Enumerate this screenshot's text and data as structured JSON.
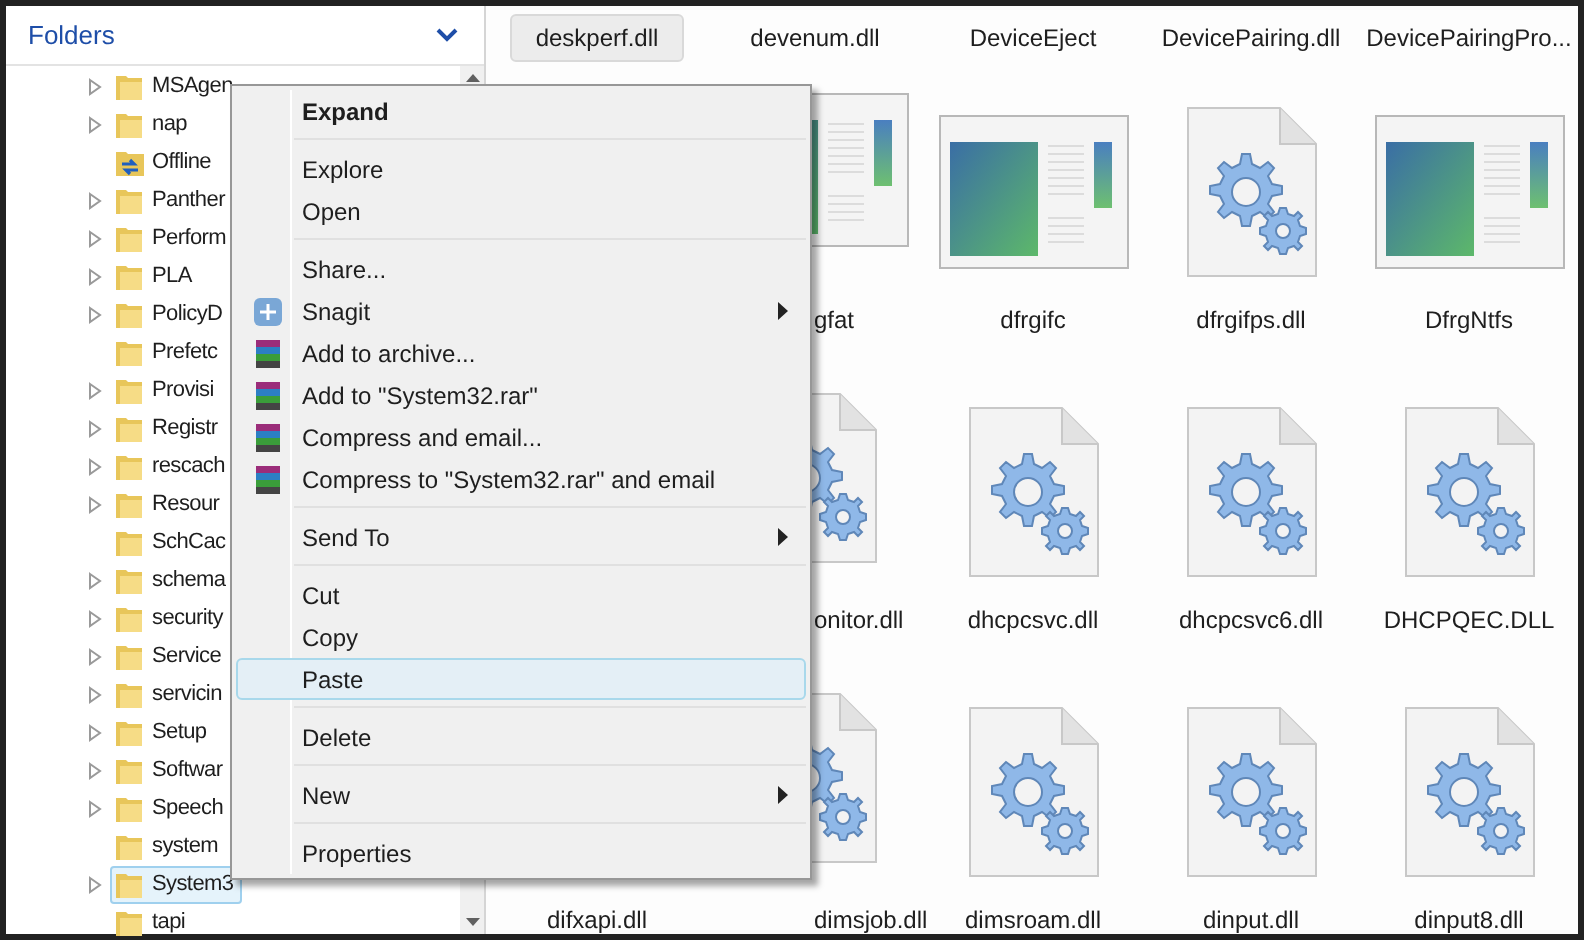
{
  "folders_pane": {
    "title": "Folders",
    "tree": [
      {
        "label": "MSAgen",
        "expander": true,
        "kind": "folder",
        "selected": false
      },
      {
        "label": "nap",
        "expander": true,
        "kind": "folder",
        "selected": false
      },
      {
        "label": "Offline",
        "expander": false,
        "kind": "sync",
        "selected": false
      },
      {
        "label": "Panther",
        "expander": true,
        "kind": "folder",
        "selected": false
      },
      {
        "label": "Perform",
        "expander": true,
        "kind": "folder",
        "selected": false
      },
      {
        "label": "PLA",
        "expander": true,
        "kind": "folder",
        "selected": false
      },
      {
        "label": "PolicyD",
        "expander": true,
        "kind": "folder",
        "selected": false
      },
      {
        "label": "Prefetc",
        "expander": false,
        "kind": "folder",
        "selected": false
      },
      {
        "label": "Provisi",
        "expander": true,
        "kind": "folder",
        "selected": false
      },
      {
        "label": "Registr",
        "expander": true,
        "kind": "folder",
        "selected": false
      },
      {
        "label": "rescach",
        "expander": true,
        "kind": "folder",
        "selected": false
      },
      {
        "label": "Resour",
        "expander": true,
        "kind": "folder",
        "selected": false
      },
      {
        "label": "SchCac",
        "expander": false,
        "kind": "folder",
        "selected": false
      },
      {
        "label": "schema",
        "expander": true,
        "kind": "folder",
        "selected": false
      },
      {
        "label": "security",
        "expander": true,
        "kind": "folder",
        "selected": false
      },
      {
        "label": "Service",
        "expander": true,
        "kind": "folder",
        "selected": false
      },
      {
        "label": "servicin",
        "expander": true,
        "kind": "folder",
        "selected": false
      },
      {
        "label": "Setup",
        "expander": true,
        "kind": "folder",
        "selected": false
      },
      {
        "label": "Softwar",
        "expander": true,
        "kind": "folder",
        "selected": false
      },
      {
        "label": "Speech",
        "expander": true,
        "kind": "folder",
        "selected": false
      },
      {
        "label": "system",
        "expander": false,
        "kind": "folder",
        "selected": false
      },
      {
        "label": "System3",
        "expander": true,
        "kind": "folder",
        "selected": true
      },
      {
        "label": "tapi",
        "expander": false,
        "kind": "folder",
        "selected": false
      }
    ]
  },
  "files": {
    "rows": [
      {
        "items": [
          {
            "label": "deskperf.dll",
            "kind": "label",
            "selected": true
          },
          {
            "label": "devenum.dll",
            "kind": "label",
            "selected": false
          },
          {
            "label": "DeviceEject",
            "kind": "label",
            "selected": false
          },
          {
            "label": "DevicePairing.dll",
            "kind": "label",
            "selected": false
          },
          {
            "label": "DevicePairingPro...",
            "kind": "label",
            "selected": false
          }
        ]
      },
      {
        "items": [
          {
            "label": "gfat",
            "kind": "app",
            "selected": false
          },
          {
            "label": "dfrgifc",
            "kind": "app",
            "selected": false
          },
          {
            "label": "dfrgifps.dll",
            "kind": "gear",
            "selected": false
          },
          {
            "label": "DfrgNtfs",
            "kind": "app",
            "selected": false
          }
        ]
      },
      {
        "items": [
          {
            "label": "onitor.dll",
            "kind": "gear",
            "selected": false
          },
          {
            "label": "dhcpcsvc.dll",
            "kind": "gear",
            "selected": false
          },
          {
            "label": "dhcpcsvc6.dll",
            "kind": "gear",
            "selected": false
          },
          {
            "label": "DHCPQEC.DLL",
            "kind": "gear",
            "selected": false
          }
        ]
      },
      {
        "items": [
          {
            "label": "difxapi.dll",
            "kind": "label",
            "selected": false
          },
          {
            "label": "dimsjob.dll",
            "kind": "gear",
            "selected": false
          },
          {
            "label": "dimsroam.dll",
            "kind": "gear",
            "selected": false
          },
          {
            "label": "dinput.dll",
            "kind": "gear",
            "selected": false
          },
          {
            "label": "dinput8.dll",
            "kind": "gear",
            "selected": false
          }
        ]
      }
    ]
  },
  "context_menu": {
    "items": [
      {
        "kind": "item",
        "label": "Expand",
        "bold": true,
        "submenu": false,
        "selected": false
      },
      {
        "kind": "separator"
      },
      {
        "kind": "item",
        "label": "Explore",
        "bold": false,
        "submenu": false,
        "selected": false
      },
      {
        "kind": "item",
        "label": "Open",
        "bold": false,
        "submenu": false,
        "selected": false
      },
      {
        "kind": "separator"
      },
      {
        "kind": "item",
        "label": "Share...",
        "bold": false,
        "submenu": false,
        "selected": false
      },
      {
        "kind": "snagit",
        "label": "Snagit",
        "bold": false,
        "submenu": true,
        "selected": false
      },
      {
        "kind": "archive",
        "label": "Add to archive...",
        "bold": false,
        "submenu": false,
        "selected": false
      },
      {
        "kind": "archive",
        "label": "Add to \"System32.rar\"",
        "bold": false,
        "submenu": false,
        "selected": false
      },
      {
        "kind": "archive",
        "label": "Compress and email...",
        "bold": false,
        "submenu": false,
        "selected": false
      },
      {
        "kind": "archive",
        "label": "Compress to \"System32.rar\" and email",
        "bold": false,
        "submenu": false,
        "selected": false
      },
      {
        "kind": "separator"
      },
      {
        "kind": "item",
        "label": "Send To",
        "bold": false,
        "submenu": true,
        "selected": false
      },
      {
        "kind": "separator"
      },
      {
        "kind": "item",
        "label": "Cut",
        "bold": false,
        "submenu": false,
        "selected": false
      },
      {
        "kind": "item",
        "label": "Copy",
        "bold": false,
        "submenu": false,
        "selected": false
      },
      {
        "kind": "item",
        "label": "Paste",
        "bold": false,
        "submenu": false,
        "selected": true
      },
      {
        "kind": "separator"
      },
      {
        "kind": "item",
        "label": "Delete",
        "bold": false,
        "submenu": false,
        "selected": false
      },
      {
        "kind": "separator"
      },
      {
        "kind": "item",
        "label": "New",
        "bold": false,
        "submenu": true,
        "selected": false
      },
      {
        "kind": "separator"
      },
      {
        "kind": "item",
        "label": "Properties",
        "bold": false,
        "submenu": false,
        "selected": false
      }
    ]
  }
}
